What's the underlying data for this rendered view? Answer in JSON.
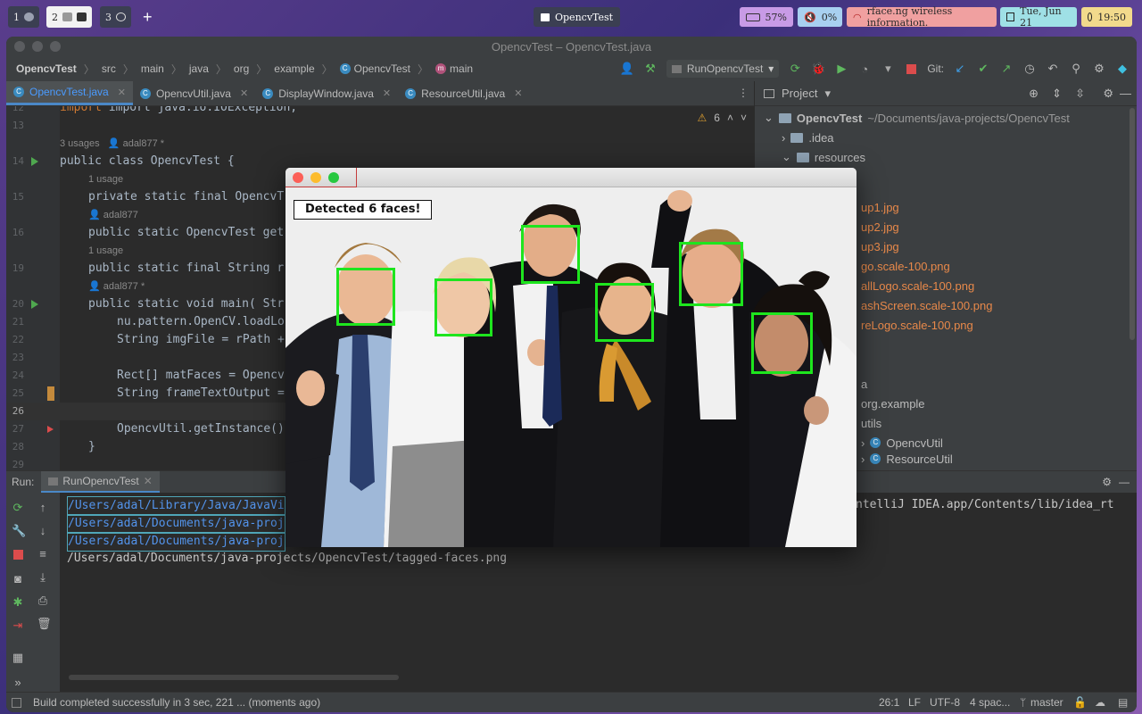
{
  "topbar": {
    "workspaces": [
      {
        "num": "1",
        "active": false
      },
      {
        "num": "2",
        "active": true
      },
      {
        "num": "3",
        "active": false
      }
    ],
    "add_label": "+",
    "window_title": "OpencvTest",
    "battery": "57%",
    "volume": "0%",
    "wifi": "rface.ng wireless information.",
    "date": "Tue, Jun 21",
    "time": "19:50",
    "colors": {
      "battery": "#c89be6",
      "volume": "#a8d0f0",
      "wifi": "#f0a0a0",
      "date": "#9fe0e6",
      "time": "#f2da8c"
    }
  },
  "ide": {
    "title": "OpencvTest – OpencvTest.java",
    "breadcrumbs": [
      "OpencvTest",
      "src",
      "main",
      "java",
      "org",
      "example",
      "OpencvTest",
      "main"
    ],
    "run_config": "RunOpencvTest",
    "git_label": "Git:",
    "tabs": [
      {
        "label": "OpencvTest.java",
        "selected": true
      },
      {
        "label": "OpencvUtil.java",
        "selected": false
      },
      {
        "label": "DisplayWindow.java",
        "selected": false
      },
      {
        "label": "ResourceUtil.java",
        "selected": false
      }
    ],
    "warnings": "6",
    "editor": {
      "lines": [
        {
          "n": "12",
          "code": "import java.io.IOException;"
        },
        {
          "n": "13",
          "code": ""
        },
        {
          "n": "14",
          "code": "public class OpencvTest {"
        },
        {
          "n": "15",
          "code": "private static final OpencvT"
        },
        {
          "n": "16",
          "code": "public static OpencvTest get"
        },
        {
          "n": "19",
          "code": "public static final String r"
        },
        {
          "n": "20",
          "code": "public static void main( Str"
        },
        {
          "n": "21",
          "code": "nu.pattern.OpenCV.loadLo"
        },
        {
          "n": "22",
          "code": "String imgFile = rPath +"
        },
        {
          "n": "23",
          "code": ""
        },
        {
          "n": "24",
          "code": "Rect[] matFaces = Opencv"
        },
        {
          "n": "25",
          "code": "String frameTextOutput ="
        },
        {
          "n": "26",
          "code": ""
        },
        {
          "n": "27",
          "code": "OpencvUtil.getInstance()"
        },
        {
          "n": "28",
          "code": "}"
        },
        {
          "n": "29",
          "code": ""
        }
      ],
      "hints": {
        "usages3": "3 usages",
        "author_star": "adal877 *",
        "usage1": "1 usage",
        "author": "adal877"
      }
    },
    "project": {
      "header": "Project",
      "root_name": "OpencvTest",
      "root_path": "~/Documents/java-projects/OpencvTest",
      "items": [
        {
          "label": ".idea"
        },
        {
          "label": "resources"
        },
        {
          "label": "up1.jpg"
        },
        {
          "label": "up2.jpg"
        },
        {
          "label": "up3.jpg"
        },
        {
          "label": "go.scale-100.png"
        },
        {
          "label": "allLogo.scale-100.png"
        },
        {
          "label": "ashScreen.scale-100.png"
        },
        {
          "label": "reLogo.scale-100.png"
        },
        {
          "label": "a"
        },
        {
          "label": "org.example"
        },
        {
          "label": "utils"
        },
        {
          "label": "OpencvUtil"
        },
        {
          "label": "ResourceUtil"
        }
      ]
    },
    "run": {
      "label": "Run:",
      "tab": "RunOpencvTest",
      "output": [
        "/Users/adal/Library/Java/JavaVi",
        "/Users/adal/Documents/java-proj",
        "/Users/adal/Documents/java-proj",
        "/Users/adal/Documents/java-projects/OpencvTest/tagged-faces.png"
      ],
      "right_fragment": "ntelliJ IDEA.app/Contents/lib/idea_rt"
    },
    "status": {
      "message": "Build completed successfully in 3 sec, 221 ... (moments ago)",
      "position": "26:1",
      "line_sep": "LF",
      "encoding": "UTF-8",
      "indent": "4 spac...",
      "branch": "master"
    }
  },
  "facewindow": {
    "label": "Detected 6 faces!",
    "face_count": 6
  }
}
